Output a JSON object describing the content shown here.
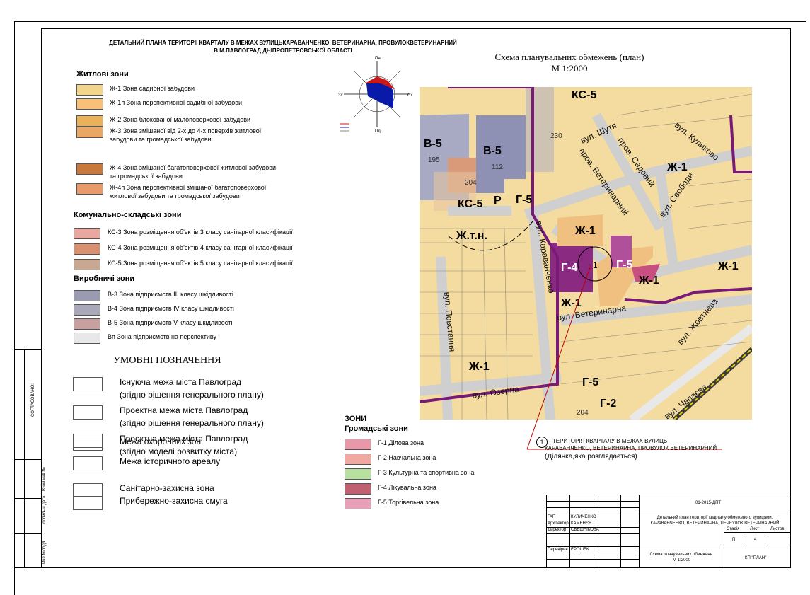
{
  "title": {
    "line1": "ДЕТАЛЬНИЙ ПЛАНА ТЕРИТОРІЇ КВАРТАЛУ В МЕЖАХ  ВУЛИЦЬКАРАВАНЧЕНКО, ВЕТЕРИНАРНА, ПРОВУЛОКВЕТЕРИНАРНИЙ",
    "line2": "В М.ПАВЛОГРАД ДНІПРОПЕТРОВСЬКОЇ ОБЛАСТІ"
  },
  "schema": {
    "title": "Схема планувальних обмежень (план)",
    "scale": "М 1:2000"
  },
  "residential": {
    "heading": "Житлові зони",
    "items": [
      {
        "code": "Ж-1",
        "text": "Ж-1   Зона садибної забудови",
        "color": "#f2d58c"
      },
      {
        "code": "Ж-1п",
        "text": "Ж-1п   Зона перспективної садибної забудови",
        "color": "#f7c17a"
      },
      {
        "code": "Ж-2",
        "text": "Ж-2   Зона блокованої  малоповерхової забудови",
        "color": "#e8b25a"
      },
      {
        "code": "Ж-3",
        "text": "Ж-3   Зона змішаної від 2-х до 4-х поверхів житлової",
        "text2": "забудови та громадської забудови",
        "color": "#e8a864"
      },
      {
        "code": "Ж-4",
        "text": "Ж-4   Зона змішаної багатоповерхової житлової забудови",
        "text2": "та громадської забудови",
        "color": "#c8783a"
      },
      {
        "code": "Ж-4п",
        "text": "Ж-4п   Зона перспективної змішаної багатоповерхової",
        "text2": "житлової забудови та громадської забудови",
        "color": "#e89a6a"
      }
    ]
  },
  "communal": {
    "heading": "Комунально-складські зони",
    "items": [
      {
        "code": "КС-3",
        "text": "КС-3   Зона  розміщення об'єктів 3 класу санітарної класифікації",
        "color": "#e8a8a0"
      },
      {
        "code": "КС-4",
        "text": "КС-4   Зона  розміщення об'єктів 4 класу санітарної класифікації",
        "color": "#d89070"
      },
      {
        "code": "КС-5",
        "text": "КС-5   Зона  розміщення об'єктів 5 класу санітарної класифікації",
        "color": "#c8a890"
      }
    ]
  },
  "industrial": {
    "heading": "Виробничі зони",
    "items": [
      {
        "code": "В-3",
        "text": "В-3   Зона підприємств ІІІ класу шкідливості",
        "color": "#9a9ab0"
      },
      {
        "code": "В-4",
        "text": "В-4   Зона підприємств ІV класу шкідливості",
        "color": "#a8a8b8"
      },
      {
        "code": "В-5",
        "text": "В-5   Зона підприємств V класу шкідливості",
        "color": "#c8a0a0"
      },
      {
        "code": "Вп",
        "text": "Вп   Зона підприємств на перспективу",
        "color": "#e8e8e8"
      }
    ]
  },
  "symbols": {
    "heading": "УМОВНІ ПОЗНАЧЕННЯ",
    "items": [
      {
        "text": "Існуюча межа міста Павлоград",
        "text2": "(згідно рішення генерального плану)"
      },
      {
        "text": "Проектна межа міста Павлоград",
        "text2": "(згідно рішення генерального плану)"
      },
      {
        "text": "Проектна межа міста Павлоград",
        "text2": "(згідно моделі розвитку міста)"
      },
      {
        "text": "Межа охоронних зон"
      },
      {
        "text": "Межа історичного ареалу"
      },
      {
        "text": "Санітарно-захисна зона"
      },
      {
        "text": "Прибережно-захисна смуга"
      }
    ]
  },
  "public": {
    "heading1": "ЗОНИ",
    "heading2": "Громадські зони",
    "items": [
      {
        "code": "Г-1",
        "text": "Г-1   Ділова зона",
        "color": "#e898a8"
      },
      {
        "code": "Г-2",
        "text": "Г-2   Навчальна зона",
        "color": "#f0a8a0"
      },
      {
        "code": "Г-3",
        "text": "Г-3   Культурна та спортивна зона",
        "color": "#b8e0a0"
      },
      {
        "code": "Г-4",
        "text": "Г-4   Лікувальна зона",
        "color": "#c06070"
      },
      {
        "code": "Г-5",
        "text": "Г-5   Торгівельна зона",
        "color": "#e8a0b8"
      }
    ]
  },
  "compass": {
    "n": "Пн",
    "s": "Пд",
    "e": "Сх",
    "w": "Зх"
  },
  "map": {
    "labels": {
      "ks5_top": "КС-5",
      "v5a": "В-5",
      "v5b": "В-5",
      "n195": "195",
      "n112": "112",
      "n204a": "204",
      "n230": "230",
      "ks5": "КС-5",
      "r": "Р",
      "g5a": "Г-5",
      "ztn": "Ж.т.н.",
      "zh1a": "Ж-1",
      "g4": "Г-4",
      "g5b": "Г-5",
      "zh1b": "Ж-1",
      "zh1c": "Ж-1",
      "zh1d": "Ж-1",
      "zh1e": "Ж-1",
      "zh1f": "Ж-1",
      "g5c": "Г-5",
      "g2": "Г-2",
      "n204b": "204",
      "one": "1",
      "st_shutia": "вул. Шутя",
      "st_kulykovo": "вул. Куликово",
      "st_sadovyi": "пров. Садовий",
      "st_veterynarnyi": "пров. Ветеринарний",
      "st_svobody": "вул. Свободи",
      "st_karavanchenko": "вул. Караванченко",
      "st_veterynarna": "вул. Ветеринарна",
      "st_povstannia": "вул. Повстання",
      "st_ozerna": "вул. Озерна",
      "st_zhovtneva": "вул. Жовтнева",
      "st_chapaieva": "вул. Чапаєва"
    }
  },
  "territory": {
    "num": "1",
    "line1": "- ТЕРИТОРІЯ КВАРТАЛУ В  МЕЖАХ  ВУЛИЦЬ",
    "line2": "КАРАВАНЧЕНКО,  ВЕТЕРИНАРНА,  ПРОВУЛОК ВЕТЕРИНАРНИЙ",
    "line3": "(Ділянка,яка розглядається)"
  },
  "stamp": {
    "code": "01-2015-ДПТ",
    "gap": "ГАП",
    "gap_name": "КУЛИЧЕНКО",
    "arch": "Архітектор",
    "arch_name": "КАМЕНЄВ",
    "dir": "Директор",
    "dir_name": "СВЕШНІКОВА",
    "check": "Перевірив",
    "check_name": "ЕРОШЕК",
    "desc1": "Детальний план території кварталу обмеженого вулицями:",
    "desc2": "КАРАВАНЧЕНКО, ВЕТЕРИНАРНА, ПЕРЕУЛОК ВЕТЕРИНАРНИЙ",
    "stage": "Стадія",
    "sheet": "Лист",
    "sheets": "Листов",
    "stage_v": "П",
    "sheet_v": "4",
    "sheet_title1": "Схема планувальних обмежень.",
    "sheet_title2": "М 1:2000",
    "org": "КП \"ПЛАН\""
  },
  "side": {
    "approved": "СОГЛАСОВАНО:",
    "inv": "Взам.инв.№",
    "sign": "Подпись и дата",
    "invp": "Инв.№подл."
  }
}
